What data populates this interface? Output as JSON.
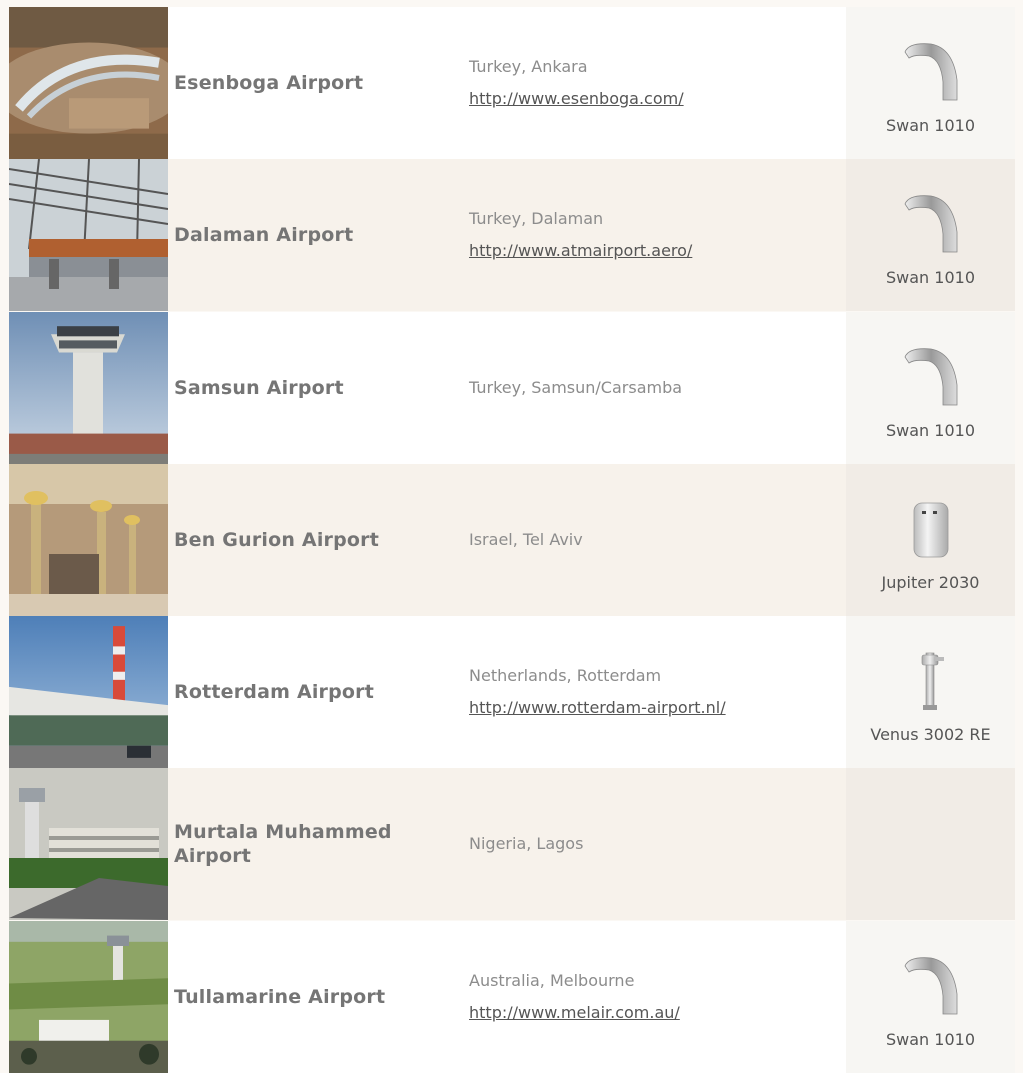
{
  "rows": [
    {
      "name": "Esenboga Airport",
      "location": "Turkey, Ankara",
      "url": "http://www.esenboga.com/",
      "product": "Swan 1010",
      "product_icon": "faucet-swan-icon",
      "photo": "airport-photo-esenboga"
    },
    {
      "name": "Dalaman Airport",
      "location": "Turkey, Dalaman",
      "url": "http://www.atmairport.aero/",
      "product": "Swan 1010",
      "product_icon": "faucet-swan-icon",
      "photo": "airport-photo-dalaman"
    },
    {
      "name": "Samsun Airport",
      "location": "Turkey, Samsun/Carsamba",
      "url": "",
      "product": "Swan 1010",
      "product_icon": "faucet-swan-icon",
      "photo": "airport-photo-samsun"
    },
    {
      "name": "Ben Gurion Airport",
      "location": "Israel, Tel Aviv",
      "url": "",
      "product": "Jupiter 2030",
      "product_icon": "hand-dryer-icon",
      "photo": "airport-photo-ben-gurion"
    },
    {
      "name": "Rotterdam Airport",
      "location": "Netherlands, Rotterdam",
      "url": "http://www.rotterdam-airport.nl/",
      "product": "Venus 3002 RE",
      "product_icon": "flush-valve-icon",
      "photo": "airport-photo-rotterdam"
    },
    {
      "name": "Murtala Muhammed Airport",
      "location": "Nigeria, Lagos",
      "url": "",
      "product": "",
      "product_icon": "",
      "photo": "airport-photo-murtala-muhammed"
    },
    {
      "name": "Tullamarine Airport",
      "location": "Australia, Melbourne",
      "url": "http://www.melair.com.au/",
      "product": "Swan 1010",
      "product_icon": "faucet-swan-icon",
      "photo": "airport-photo-tullamarine"
    }
  ],
  "colors": {
    "page_bg": "#fbf8f4",
    "row_light": "#ffffff",
    "row_tan": "#f7f2eb",
    "text_name": "#757575",
    "text_muted": "#8c8c8c",
    "link": "#555555"
  }
}
